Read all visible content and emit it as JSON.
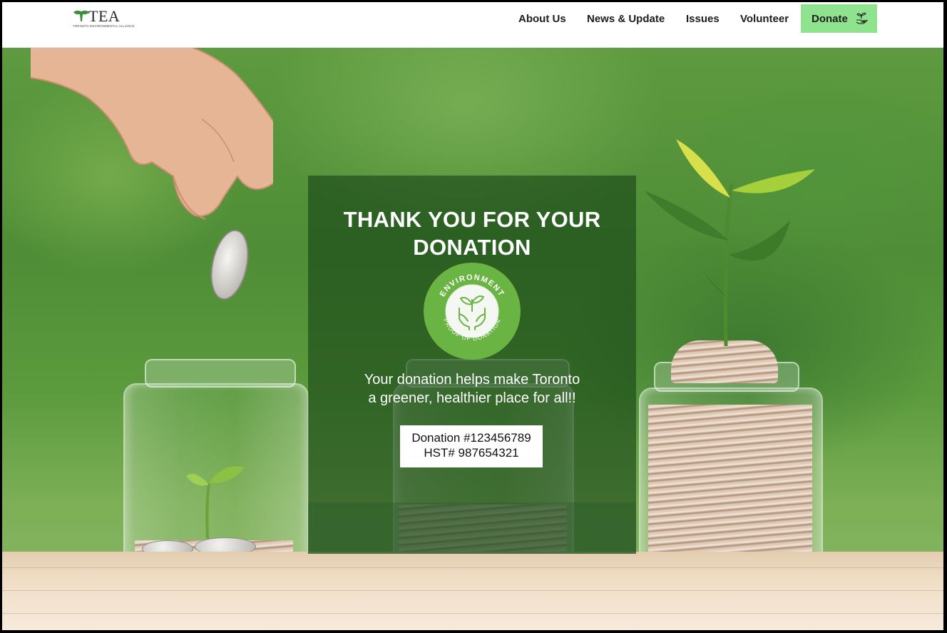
{
  "header": {
    "logo": {
      "word": "TEA",
      "subtitle": "TORONTO ENVIRONMENTAL ALLIANCE"
    },
    "nav": [
      {
        "label": "About Us"
      },
      {
        "label": "News & Update"
      },
      {
        "label": "Issues"
      },
      {
        "label": "Volunteer"
      }
    ],
    "donate_button": {
      "label": "Donate",
      "icon": "hand-plant-icon",
      "color": "#8fe38f"
    }
  },
  "card": {
    "title_line1": "THANK YOU FOR YOUR",
    "title_line2": "DONATION",
    "badge": {
      "top_text": "ENVIRONMENT",
      "bottom_text": "PROOF OF DONATION",
      "icon": "hands-sprout-icon",
      "color": "#6ab443"
    },
    "message_line1": "Your donation helps make Toronto",
    "message_line2": "a greener, healthier place for all!!",
    "receipt": {
      "donation": "Donation #123456789",
      "hst": "HST# 987654321"
    }
  },
  "colors": {
    "accent": "#8fe38f",
    "card_overlay": "#164416",
    "badge_green": "#6ab443"
  }
}
